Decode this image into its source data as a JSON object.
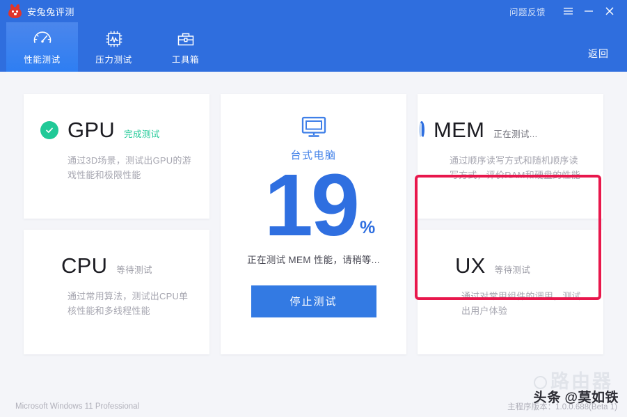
{
  "window": {
    "app_title": "安兔兔评测",
    "logo_icon": "antutu-rabbit-logo",
    "feedback_label": "问题反馈",
    "menu_icon": "hamburger-menu-icon",
    "minimize_icon": "minimize-icon",
    "close_icon": "close-icon"
  },
  "nav": {
    "tabs": [
      {
        "label": "性能测试",
        "icon": "speedometer-icon",
        "active": true
      },
      {
        "label": "压力测试",
        "icon": "cpu-chip-waveform-icon",
        "active": false
      },
      {
        "label": "工具箱",
        "icon": "toolbox-icon",
        "active": false
      }
    ],
    "back_label": "返回"
  },
  "tests": [
    {
      "id": "gpu",
      "name": "GPU",
      "status": "完成测试",
      "status_kind": "done",
      "icon": "green-check-circle-icon",
      "desc": "通过3D场景，测试出GPU的游戏性能和极限性能"
    },
    {
      "id": "cpu",
      "name": "CPU",
      "status": "等待测试",
      "status_kind": "waiting",
      "icon": "blue-square-dot-icon",
      "desc": "通过常用算法，测试出CPU单核性能和多线程性能"
    },
    {
      "id": "mem",
      "name": "MEM",
      "status": "正在测试...",
      "status_kind": "running",
      "icon": "loading-spinner-icon",
      "desc": "通过顺序读写方式和随机顺序读写方式，评价RAM和硬盘的性能",
      "highlighted": true
    },
    {
      "id": "ux",
      "name": "UX",
      "status": "等待测试",
      "status_kind": "waiting",
      "icon": "blue-square-dot-icon",
      "desc": "通过对常用组件的调用，测试出用户体验"
    }
  ],
  "progress_panel": {
    "device_icon": "desktop-monitor-icon",
    "device_label": "台式电脑",
    "percent_value": "19",
    "percent_symbol": "%",
    "running_message": "正在测试 MEM 性能，请稍等...",
    "stop_button_label": "停止测试"
  },
  "footer": {
    "os_name": "Microsoft Windows 11 Professional",
    "version_text": "主程序版本：1.0.0.688(Beta 1)"
  },
  "watermark": {
    "platform": "头条",
    "handle": "@莫如铁",
    "ghost_text": "路由器"
  },
  "colors": {
    "header_blue": "#2f6ede",
    "accent_blue": "#337ae3",
    "success_green": "#20c997",
    "highlight_red": "#e8174c",
    "page_bg": "#f4f5f9",
    "muted_text": "#a6a6b0"
  }
}
